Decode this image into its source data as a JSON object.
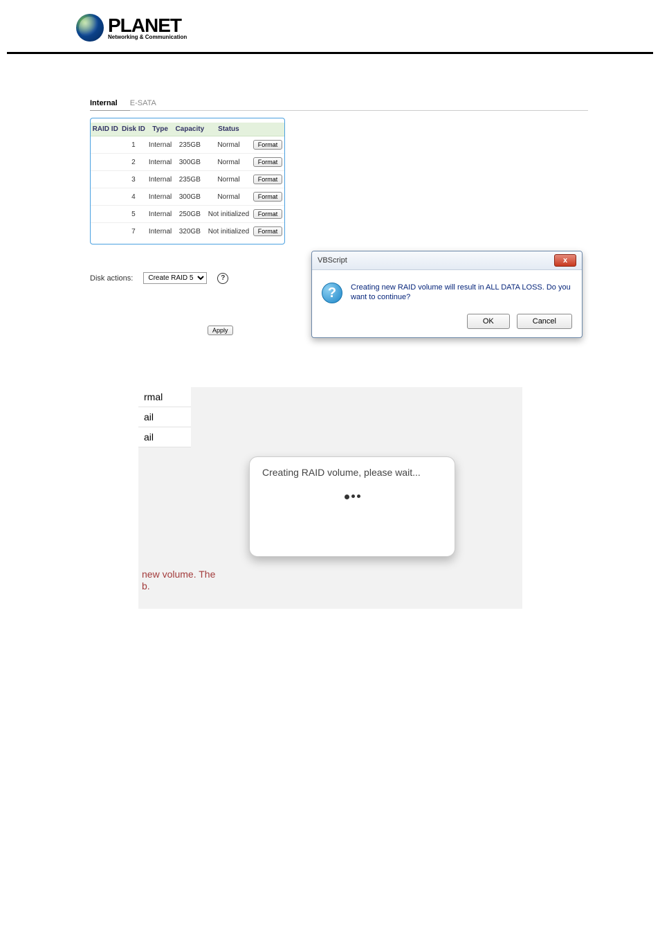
{
  "logo": {
    "brand": "PLANET",
    "subtitle": "Networking & Communication"
  },
  "tabs": {
    "active": "Internal",
    "inactive": "E-SATA"
  },
  "table": {
    "headers": {
      "raid": "RAID ID",
      "disk": "Disk ID",
      "type": "Type",
      "cap": "Capacity",
      "status": "Status"
    },
    "rows": [
      {
        "raid": "",
        "disk": "1",
        "type": "Internal",
        "cap": "235GB",
        "status": "Normal",
        "btn": "Format"
      },
      {
        "raid": "",
        "disk": "2",
        "type": "Internal",
        "cap": "300GB",
        "status": "Normal",
        "btn": "Format"
      },
      {
        "raid": "",
        "disk": "3",
        "type": "Internal",
        "cap": "235GB",
        "status": "Normal",
        "btn": "Format"
      },
      {
        "raid": "",
        "disk": "4",
        "type": "Internal",
        "cap": "300GB",
        "status": "Normal",
        "btn": "Format"
      },
      {
        "raid": "",
        "disk": "5",
        "type": "Internal",
        "cap": "250GB",
        "status": "Not initialized",
        "btn": "Format"
      },
      {
        "raid": "",
        "disk": "7",
        "type": "Internal",
        "cap": "320GB",
        "status": "Not initialized",
        "btn": "Format"
      }
    ]
  },
  "actions": {
    "label": "Disk actions:",
    "select_value": "Create RAID 5",
    "help": "?"
  },
  "apply": "Apply",
  "vbs": {
    "title": "VBScript",
    "close_glyph": "x",
    "q": "?",
    "msg": "Creating new RAID volume will result in ALL DATA LOSS. Do you want to continue?",
    "ok": "OK",
    "cancel": "Cancel"
  },
  "snippet": {
    "c1": "rmal",
    "c2": "ail",
    "c3": "ail",
    "modal": "Creating RAID volume, please wait...",
    "red1": "new volume. The",
    "red2": "b."
  }
}
